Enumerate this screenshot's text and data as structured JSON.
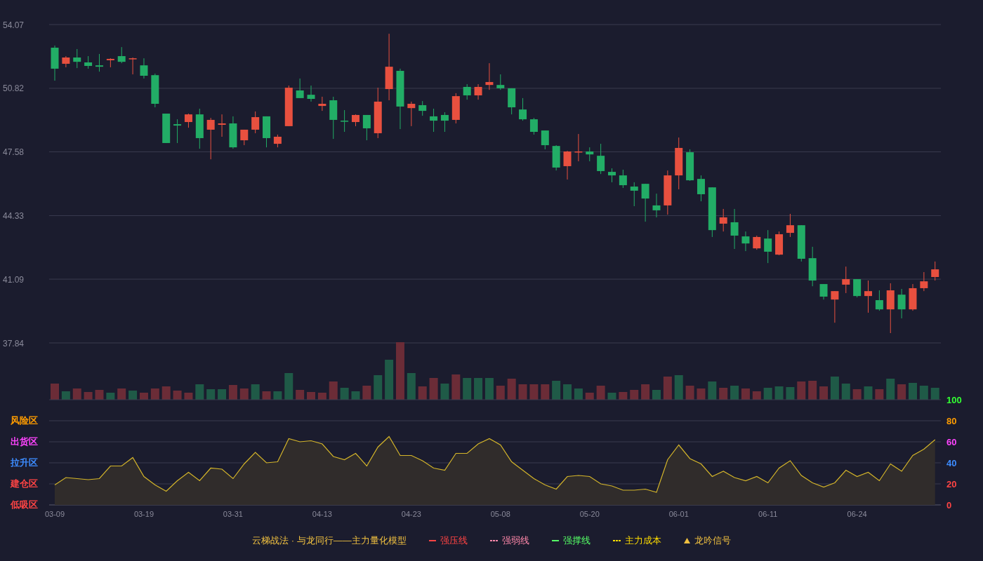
{
  "price_chart": {
    "chart_data": {
      "type": "candlestick",
      "grid": true,
      "categories": [
        null,
        null,
        null,
        null,
        null,
        null,
        null,
        null,
        null,
        null,
        null,
        null,
        null,
        null,
        null,
        null,
        null,
        null,
        null,
        null,
        null,
        null,
        null,
        null,
        null,
        null,
        null,
        null,
        null,
        null,
        null,
        null,
        null,
        null,
        null,
        null,
        null,
        null,
        null,
        null,
        null,
        null,
        null,
        null,
        null,
        null,
        null,
        null,
        null,
        null,
        null,
        null,
        null,
        null,
        null,
        null,
        null,
        null,
        null,
        null,
        null,
        null,
        null,
        null,
        null,
        null,
        null,
        null,
        null,
        null,
        null,
        null,
        null,
        null,
        null,
        null,
        null,
        null,
        null,
        null
      ],
      "ylim": [
        37.84,
        54.07
      ],
      "yticks": [
        {
          "value": 54.07,
          "label": "54.07"
        },
        {
          "value": 50.82,
          "label": "50.82"
        },
        {
          "value": 47.58,
          "label": "47.58"
        },
        {
          "value": 44.33,
          "label": "44.33"
        },
        {
          "value": 41.09,
          "label": "41.09"
        },
        {
          "value": 37.84,
          "label": "37.84"
        }
      ],
      "ohlc": [
        [
          52.89,
          53.0,
          51.21,
          51.82
        ],
        [
          52.07,
          52.46,
          51.89,
          52.39
        ],
        [
          52.39,
          52.82,
          51.85,
          52.17
        ],
        [
          52.14,
          52.46,
          51.82,
          51.96
        ],
        [
          51.99,
          52.57,
          51.67,
          51.92
        ],
        [
          52.25,
          52.35,
          51.89,
          52.32
        ],
        [
          52.46,
          52.92,
          52.1,
          52.17
        ],
        [
          52.32,
          52.39,
          51.53,
          52.35
        ],
        [
          51.99,
          52.35,
          51.32,
          51.46
        ],
        [
          51.49,
          51.57,
          49.85,
          50.03
        ],
        [
          49.53,
          49.53,
          48.03,
          48.03
        ],
        [
          48.99,
          49.24,
          48.03,
          48.92
        ],
        [
          49.1,
          49.53,
          48.81,
          49.49
        ],
        [
          49.49,
          49.78,
          47.74,
          48.28
        ],
        [
          48.71,
          49.31,
          47.2,
          49.21
        ],
        [
          48.96,
          49.49,
          48.35,
          49.03
        ],
        [
          49.03,
          49.39,
          47.74,
          47.81
        ],
        [
          48.17,
          48.71,
          47.92,
          48.71
        ],
        [
          48.71,
          49.64,
          48.53,
          49.35
        ],
        [
          49.39,
          49.39,
          47.81,
          48.28
        ],
        [
          47.99,
          48.46,
          47.81,
          48.35
        ],
        [
          48.89,
          50.96,
          48.89,
          50.85
        ],
        [
          50.71,
          51.32,
          50.32,
          50.32
        ],
        [
          50.49,
          50.96,
          50.14,
          50.28
        ],
        [
          49.92,
          50.39,
          49.67,
          50.03
        ],
        [
          50.21,
          50.39,
          48.24,
          49.21
        ],
        [
          49.17,
          49.71,
          48.6,
          49.14
        ],
        [
          49.1,
          49.49,
          48.89,
          49.46
        ],
        [
          49.46,
          49.46,
          48.17,
          48.78
        ],
        [
          48.53,
          50.85,
          48.28,
          50.14
        ],
        [
          50.78,
          53.6,
          50.21,
          51.92
        ],
        [
          51.71,
          51.82,
          48.74,
          49.89
        ],
        [
          49.81,
          50.14,
          48.89,
          50.03
        ],
        [
          49.96,
          50.17,
          49.42,
          49.67
        ],
        [
          49.39,
          49.78,
          48.6,
          49.17
        ],
        [
          49.46,
          49.6,
          48.6,
          49.17
        ],
        [
          49.21,
          50.57,
          49.03,
          50.42
        ],
        [
          50.89,
          51.03,
          50.24,
          50.46
        ],
        [
          50.46,
          51.03,
          50.24,
          50.89
        ],
        [
          50.99,
          52.1,
          50.74,
          51.14
        ],
        [
          50.99,
          51.53,
          50.74,
          50.82
        ],
        [
          50.82,
          50.82,
          49.49,
          49.85
        ],
        [
          49.74,
          50.32,
          49.17,
          49.24
        ],
        [
          49.24,
          49.31,
          48.46,
          48.6
        ],
        [
          48.67,
          48.67,
          47.71,
          47.92
        ],
        [
          47.88,
          47.92,
          46.63,
          46.78
        ],
        [
          46.85,
          47.63,
          46.17,
          47.6
        ],
        [
          47.56,
          48.49,
          47.1,
          47.6
        ],
        [
          47.6,
          47.81,
          47.1,
          47.45
        ],
        [
          47.38,
          47.99,
          46.45,
          46.6
        ],
        [
          46.56,
          46.74,
          46.03,
          46.38
        ],
        [
          46.38,
          46.67,
          45.74,
          45.88
        ],
        [
          45.81,
          46.03,
          44.81,
          45.6
        ],
        [
          45.95,
          45.95,
          44.02,
          45.2
        ],
        [
          44.85,
          45.45,
          44.24,
          44.6
        ],
        [
          44.85,
          46.63,
          44.38,
          46.38
        ],
        [
          46.38,
          48.31,
          45.67,
          47.78
        ],
        [
          47.56,
          47.71,
          46.1,
          46.13
        ],
        [
          46.2,
          46.38,
          45.06,
          45.42
        ],
        [
          45.77,
          45.77,
          43.24,
          43.59
        ],
        [
          43.92,
          44.67,
          43.52,
          44.24
        ],
        [
          43.99,
          44.67,
          42.63,
          43.31
        ],
        [
          43.27,
          43.52,
          42.52,
          42.91
        ],
        [
          42.66,
          43.31,
          42.59,
          43.24
        ],
        [
          43.16,
          43.59,
          41.91,
          42.49
        ],
        [
          42.34,
          43.52,
          42.31,
          43.38
        ],
        [
          43.45,
          44.42,
          43.24,
          43.84
        ],
        [
          43.84,
          43.84,
          41.99,
          42.13
        ],
        [
          42.16,
          42.74,
          40.73,
          41.02
        ],
        [
          40.84,
          40.84,
          40.05,
          40.2
        ],
        [
          40.05,
          40.48,
          38.87,
          40.48
        ],
        [
          40.81,
          41.73,
          40.38,
          41.09
        ],
        [
          41.09,
          41.09,
          40.16,
          40.23
        ],
        [
          40.23,
          41.02,
          39.38,
          40.48
        ],
        [
          40.02,
          40.52,
          39.48,
          39.55
        ],
        [
          39.55,
          40.88,
          38.34,
          40.52
        ],
        [
          40.3,
          40.59,
          39.09,
          39.55
        ],
        [
          39.55,
          40.84,
          39.48,
          40.63
        ],
        [
          40.63,
          41.45,
          40.48,
          40.98
        ],
        [
          41.2,
          41.99,
          41.02,
          41.59
        ]
      ]
    }
  },
  "oscillator": {
    "zones": [
      {
        "label": "风险区",
        "color": "#ff9c00"
      },
      {
        "label": "出货区",
        "color": "#ff44ff"
      },
      {
        "label": "拉升区",
        "color": "#3d8cff"
      },
      {
        "label": "建仓区",
        "color": "#ff4444"
      },
      {
        "label": "低吸区",
        "color": "#ff4444"
      }
    ],
    "chart_data": {
      "type": "area",
      "grid": true,
      "categories": [
        "03-09",
        null,
        null,
        null,
        null,
        null,
        null,
        null,
        "03-19",
        null,
        null,
        null,
        null,
        null,
        null,
        null,
        "03-31",
        null,
        null,
        null,
        null,
        null,
        null,
        null,
        "04-13",
        null,
        null,
        null,
        null,
        null,
        null,
        null,
        "04-23",
        null,
        null,
        null,
        null,
        null,
        null,
        null,
        "05-08",
        null,
        null,
        null,
        null,
        null,
        null,
        null,
        "05-20",
        null,
        null,
        null,
        null,
        null,
        null,
        null,
        "06-01",
        null,
        null,
        null,
        null,
        null,
        null,
        null,
        "06-11",
        null,
        null,
        null,
        null,
        null,
        null,
        null,
        "06-24",
        null,
        null,
        null,
        null,
        null,
        null,
        null
      ],
      "series": [
        {
          "color": "#d4b52a",
          "values": [
            19,
            26,
            25,
            24,
            25,
            37,
            37,
            45,
            27,
            19,
            13,
            23,
            31,
            23,
            35,
            34,
            25,
            39,
            50,
            40,
            41,
            63,
            60,
            61,
            58,
            46,
            43,
            49,
            37,
            55,
            65,
            47,
            47,
            42,
            35,
            33,
            49,
            49,
            58,
            63,
            57,
            41,
            33,
            25,
            19,
            15,
            27,
            28,
            27,
            20,
            18,
            14,
            14,
            15,
            12,
            43,
            57,
            44,
            39,
            27,
            32,
            26,
            23,
            27,
            21,
            35,
            42,
            28,
            21,
            17,
            21,
            33,
            27,
            31,
            23,
            39,
            32,
            47,
            53,
            62
          ]
        }
      ],
      "ylim": [
        0,
        100
      ],
      "yticks": [
        {
          "value": 100,
          "label": "100"
        },
        {
          "value": 80,
          "label": "80"
        },
        {
          "value": 60,
          "label": "60"
        },
        {
          "value": 40,
          "label": "40"
        },
        {
          "value": 20,
          "label": "20"
        },
        {
          "value": 0,
          "label": "0"
        }
      ]
    }
  },
  "legend": {
    "title": "云梯战法 · 与龙同行——主力量化模型",
    "items": [
      {
        "label": "强压线",
        "color": "#ff4444",
        "kind": "line"
      },
      {
        "label": "强弱线",
        "color": "#ff88aa",
        "kind": "dashed"
      },
      {
        "label": "强撑线",
        "color": "#55ff66",
        "kind": "line"
      },
      {
        "label": "主力成本",
        "color": "#ffdd00",
        "kind": "dashed"
      },
      {
        "label": "龙吟信号",
        "color": "#f0c040",
        "kind": "triangle"
      }
    ]
  }
}
